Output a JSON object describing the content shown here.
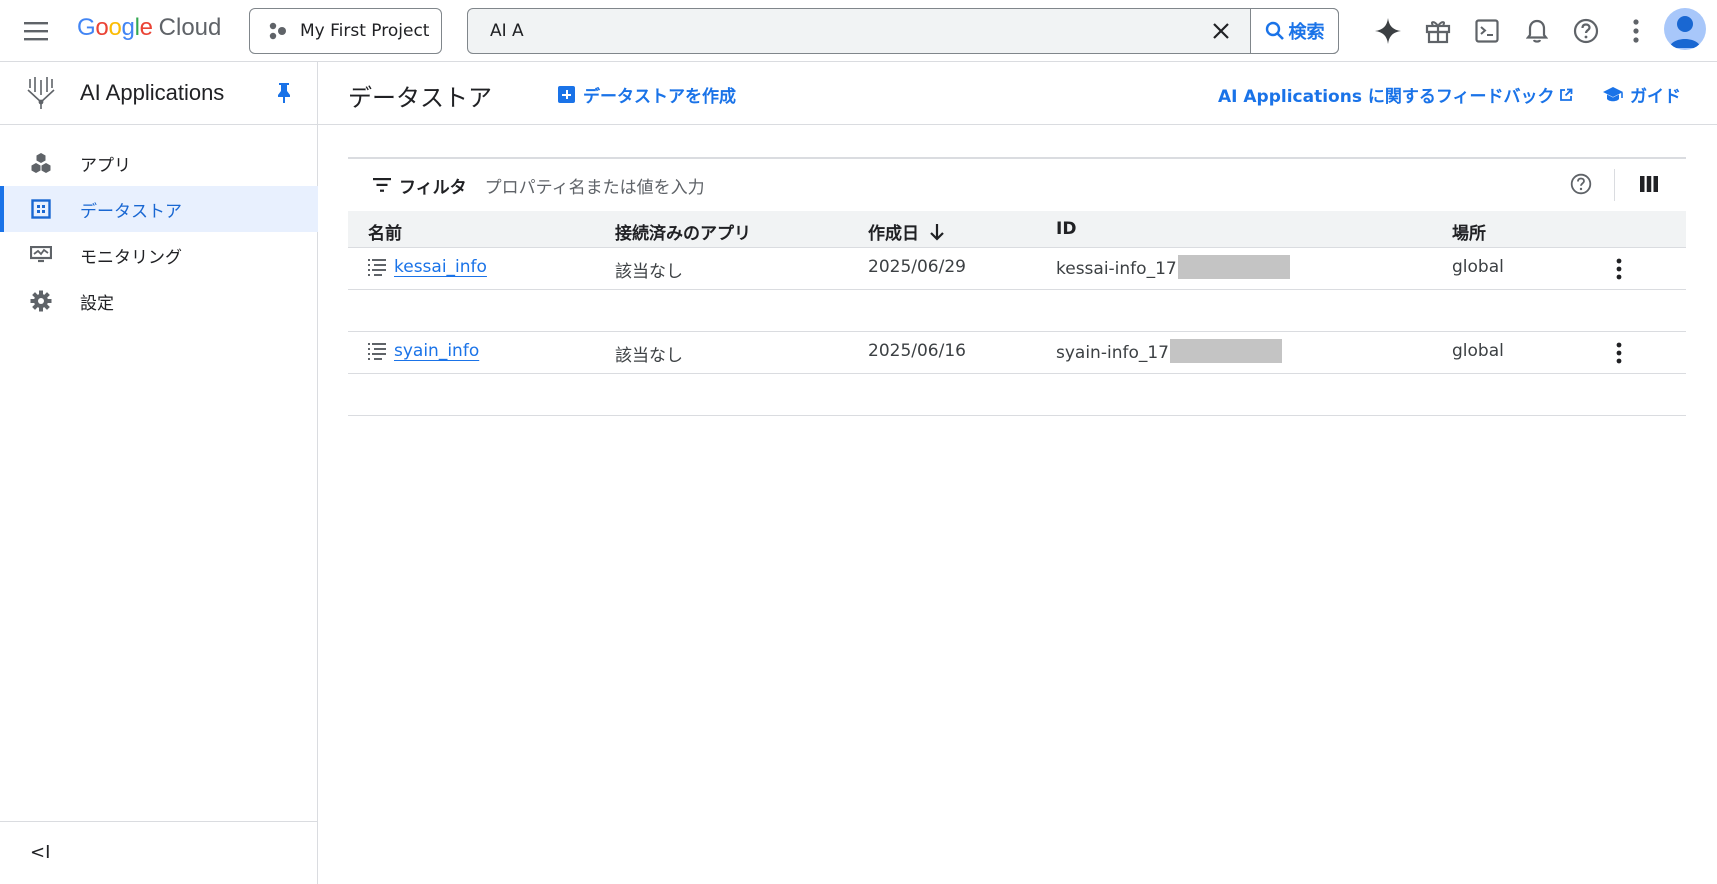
{
  "topbar": {
    "logo_google": "Google",
    "logo_cloud": "Cloud",
    "project": "My First Project",
    "search_value": "AI A",
    "search_button": "検索"
  },
  "sidebar": {
    "title": "AI Applications",
    "items": [
      {
        "label": "アプリ",
        "icon": "apps-icon"
      },
      {
        "label": "データストア",
        "icon": "datastore-icon",
        "active": true
      },
      {
        "label": "モニタリング",
        "icon": "monitoring-icon"
      },
      {
        "label": "設定",
        "icon": "settings-gear-icon"
      }
    ],
    "collapse": "<I"
  },
  "main": {
    "title": "データストア",
    "create_button": "データストアを作成",
    "feedback_link": "AI Applications に関するフィードバック",
    "guide_link": "ガイド"
  },
  "filter": {
    "label": "フィルタ",
    "placeholder": "プロパティ名または値を入力"
  },
  "table": {
    "columns": [
      "名前",
      "接続済みのアプリ",
      "作成日",
      "ID",
      "場所"
    ],
    "rows": [
      {
        "name": "kessai_info",
        "apps": "該当なし",
        "created": "2025/06/29",
        "id": "kessai-info_17",
        "location": "global"
      },
      {
        "name": "syain_info",
        "apps": "該当なし",
        "created": "2025/06/16",
        "id": "syain-info_17",
        "location": "global"
      }
    ]
  },
  "colors": {
    "accent": "#1a73e8",
    "active_bg": "#e8f0fe",
    "header_bg": "#f1f3f4",
    "border": "#dadce0"
  }
}
